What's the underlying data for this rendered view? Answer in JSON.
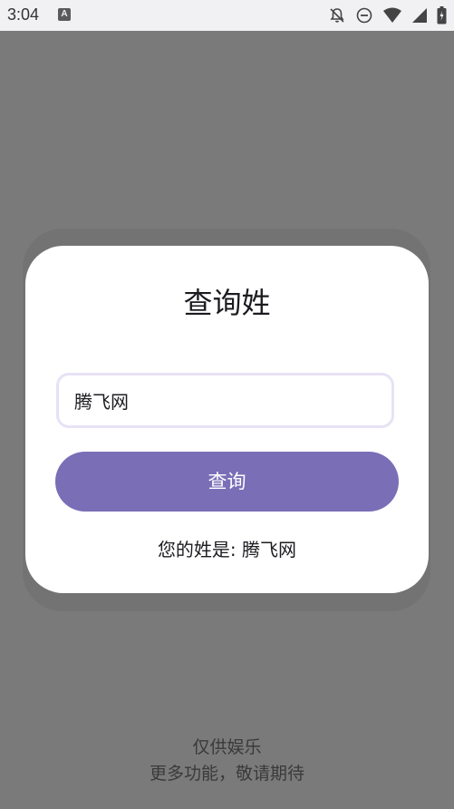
{
  "status_bar": {
    "time": "3:04",
    "app_icon_letter": "A",
    "icons": [
      "notifications-off-icon",
      "do-not-disturb-icon",
      "wifi-icon",
      "signal-icon",
      "battery-icon"
    ]
  },
  "dialog": {
    "title": "查询姓",
    "input_value": "腾飞网",
    "button_label": "查询",
    "result_label": "您的姓是: ",
    "result_value": "腾飞网"
  },
  "footer": {
    "line1": "仅供娱乐",
    "line2": "更多功能，敬请期待"
  },
  "colors": {
    "accent": "#7a6eb7",
    "scrim": "#7a7a7a",
    "status_bar_bg": "#f1f0f3",
    "input_border": "#e7e2f4"
  }
}
